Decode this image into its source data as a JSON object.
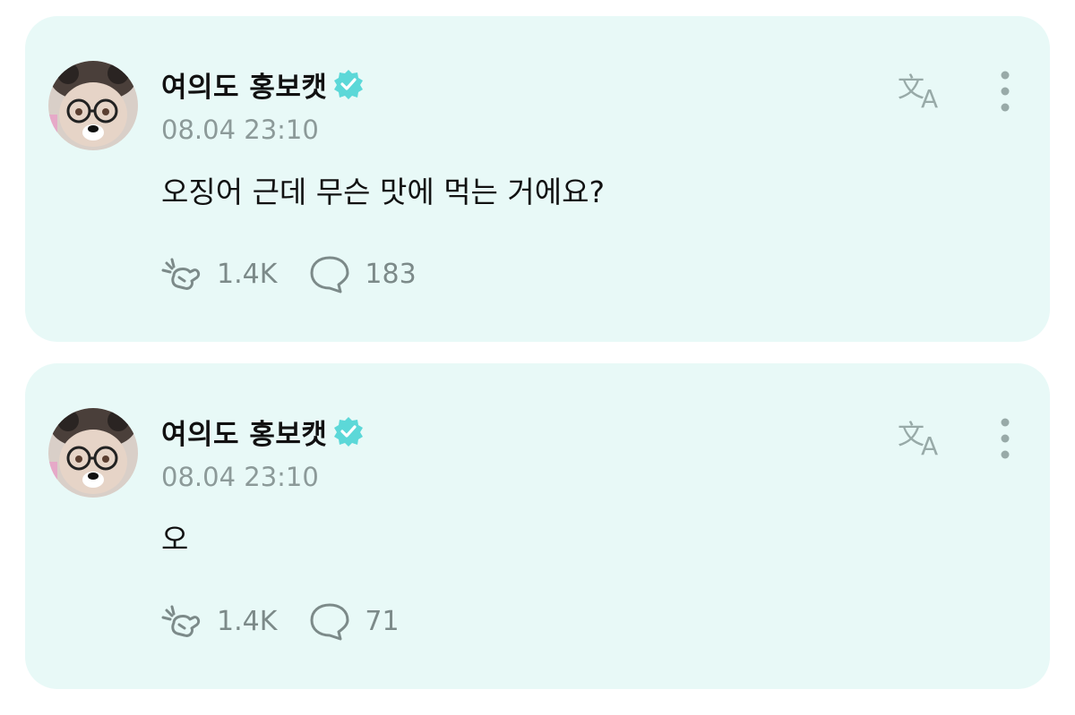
{
  "colors": {
    "card_background": "#e8f9f7",
    "verified_badge": "#5cd8d8",
    "icon_gray": "#98aaa8",
    "timestamp_gray": "#8c9a99"
  },
  "posts": [
    {
      "author": "여의도 홍보캣",
      "verified_icon": "verified-badge-icon",
      "timestamp": "08.04 23:10",
      "text": "오징어 근데 무슨 맛에 먹는 거에요?",
      "reactions": "1.4K",
      "comments": "183"
    },
    {
      "author": "여의도 홍보캣",
      "verified_icon": "verified-badge-icon",
      "timestamp": "08.04 23:10",
      "text": "오",
      "reactions": "1.4K",
      "comments": "71"
    }
  ]
}
